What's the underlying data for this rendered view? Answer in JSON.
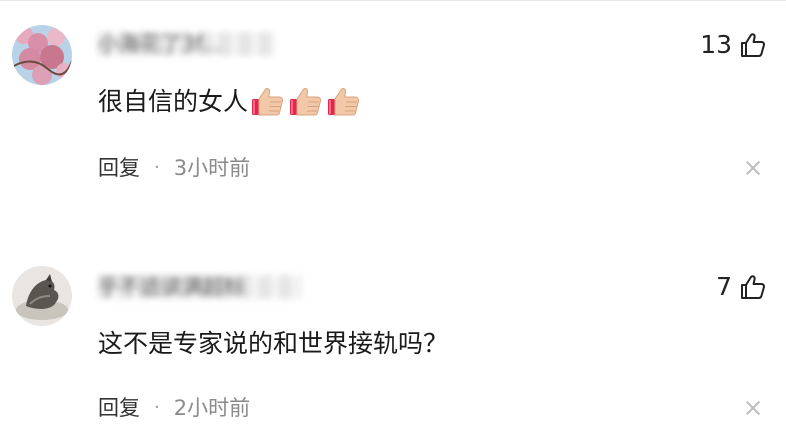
{
  "comments": [
    {
      "username": "小海花了3f...",
      "likes": "13",
      "text": "很自信的女人",
      "emoji": "thumbs-up",
      "emoji_count": 3,
      "reply_label": "回复",
      "separator": "·",
      "time": "3小时前",
      "avatar": "cherry-blossom-avatar"
    },
    {
      "username": "乎不适读满超标",
      "likes": "7",
      "text": "这不是专家说的和世界接轨吗？",
      "reply_label": "回复",
      "separator": "·",
      "time": "2小时前",
      "avatar": "wolf-sketch-avatar"
    }
  ],
  "colors": {
    "text": "#1a1a1a",
    "meta": "#8a8a8a",
    "close": "#bdbdbd",
    "thumb": "#f2c9a8",
    "cuff": "#e0284f"
  },
  "icons": {
    "like": "thumbs-up-outline-icon",
    "close": "close-icon"
  }
}
